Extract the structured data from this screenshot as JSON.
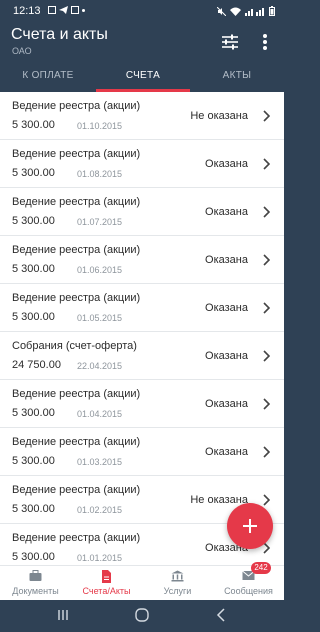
{
  "status_bar": {
    "time": "12:13"
  },
  "header": {
    "title": "Счета и акты",
    "subtitle": "ОАО"
  },
  "tabs": [
    {
      "label": "К ОПЛАТЕ",
      "active": false
    },
    {
      "label": "СЧЕТА",
      "active": true
    },
    {
      "label": "АКТЫ",
      "active": false
    }
  ],
  "invoices": [
    {
      "name": "Ведение реестра (акции)",
      "amount": "5 300.00",
      "date": "01.10.2015",
      "status": "Не оказана"
    },
    {
      "name": "Ведение реестра (акции)",
      "amount": "5 300.00",
      "date": "01.08.2015",
      "status": "Оказана"
    },
    {
      "name": "Ведение реестра (акции)",
      "amount": "5 300.00",
      "date": "01.07.2015",
      "status": "Оказана"
    },
    {
      "name": "Ведение реестра (акции)",
      "amount": "5 300.00",
      "date": "01.06.2015",
      "status": "Оказана"
    },
    {
      "name": "Ведение реестра (акции)",
      "amount": "5 300.00",
      "date": "01.05.2015",
      "status": "Оказана"
    },
    {
      "name": "Собрания (счет-оферта)",
      "amount": "24 750.00",
      "date": "22.04.2015",
      "status": "Оказана"
    },
    {
      "name": "Ведение реестра (акции)",
      "amount": "5 300.00",
      "date": "01.04.2015",
      "status": "Оказана"
    },
    {
      "name": "Ведение реестра (акции)",
      "amount": "5 300.00",
      "date": "01.03.2015",
      "status": "Оказана"
    },
    {
      "name": "Ведение реестра (акции)",
      "amount": "5 300.00",
      "date": "01.02.2015",
      "status": "Не оказана"
    },
    {
      "name": "Ведение реестра (акции)",
      "amount": "5 300.00",
      "date": "01.01.2015",
      "status": "Оказана"
    }
  ],
  "bottom_nav": {
    "documents": "Документы",
    "invoices": "Счета/Акты",
    "services": "Услуги",
    "messages": "Сообщения",
    "messages_badge": "242"
  },
  "colors": {
    "header_bg": "#2f4155",
    "accent": "#e53949"
  },
  "icons": {
    "fab": "plus-icon",
    "filter": "sliders-icon",
    "more": "more-vertical-icon",
    "documents": "briefcase-icon",
    "invoices": "document-icon",
    "services": "bank-icon",
    "messages": "envelope-icon"
  }
}
